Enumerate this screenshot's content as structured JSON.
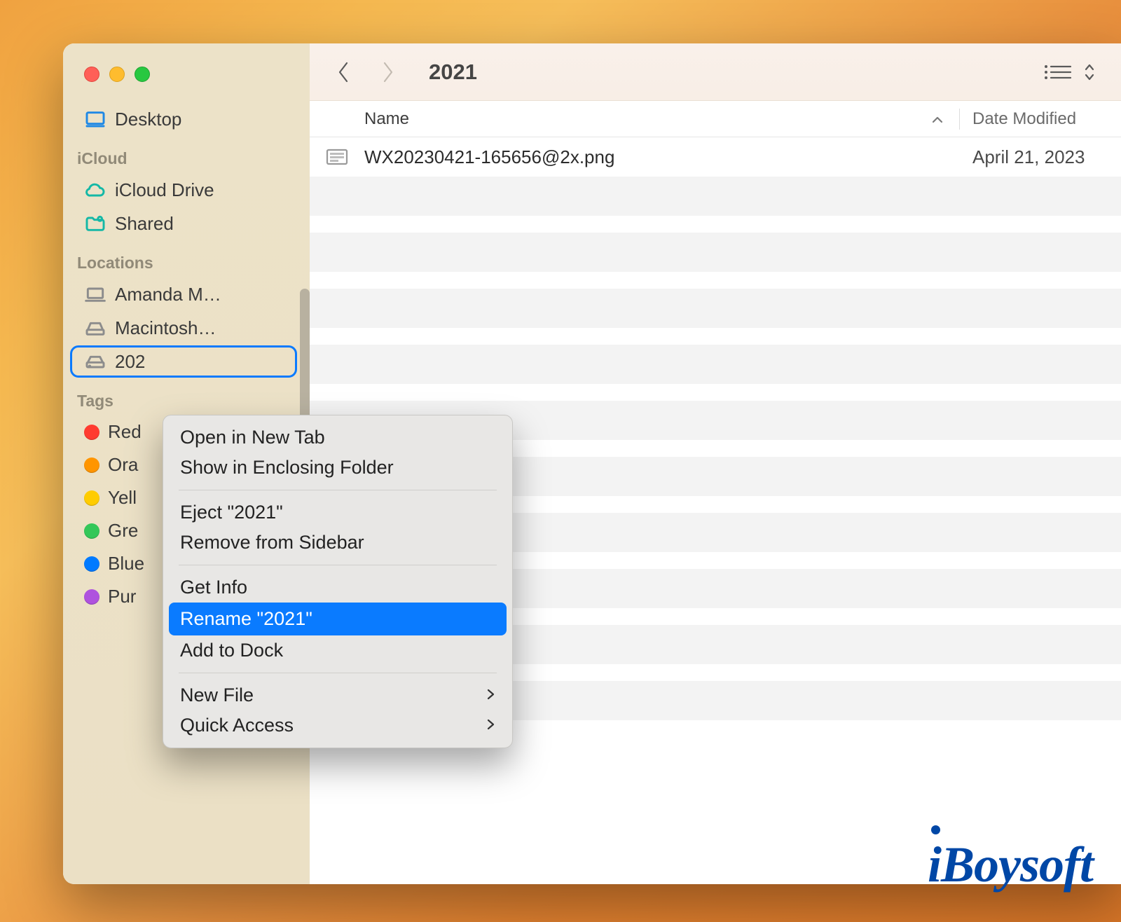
{
  "window": {
    "title": "2021"
  },
  "sidebar": {
    "favorites": [
      {
        "label": "Desktop",
        "icon": "desktop"
      }
    ],
    "icloud_section": "iCloud",
    "icloud": [
      {
        "label": "iCloud Drive",
        "icon": "cloud"
      },
      {
        "label": "Shared",
        "icon": "shared-folder"
      }
    ],
    "locations_section": "Locations",
    "locations": [
      {
        "label": "Amanda M…",
        "icon": "laptop"
      },
      {
        "label": "Macintosh…",
        "icon": "hdd"
      },
      {
        "label": "202",
        "icon": "disk-image"
      }
    ],
    "tags_section": "Tags",
    "tags": [
      {
        "label": "Red",
        "color": "#ff3b30"
      },
      {
        "label": "Ora",
        "color": "#ff9500"
      },
      {
        "label": "Yell",
        "color": "#ffcc00"
      },
      {
        "label": "Gre",
        "color": "#34c759"
      },
      {
        "label": "Blue",
        "color": "#007aff"
      },
      {
        "label": "Pur",
        "color": "#af52de"
      }
    ]
  },
  "columns": {
    "name": "Name",
    "date_modified": "Date Modified"
  },
  "files": [
    {
      "name": "WX20230421-165656@2x.png",
      "date": "April 21, 2023"
    }
  ],
  "context_menu": {
    "open_new_tab": "Open in New Tab",
    "show_enclosing": "Show in Enclosing Folder",
    "eject": "Eject \"2021\"",
    "remove_sidebar": "Remove from Sidebar",
    "get_info": "Get Info",
    "rename": "Rename \"2021\"",
    "add_to_dock": "Add to Dock",
    "new_file": "New File",
    "quick_access": "Quick Access"
  },
  "watermark": "iBoysoft"
}
